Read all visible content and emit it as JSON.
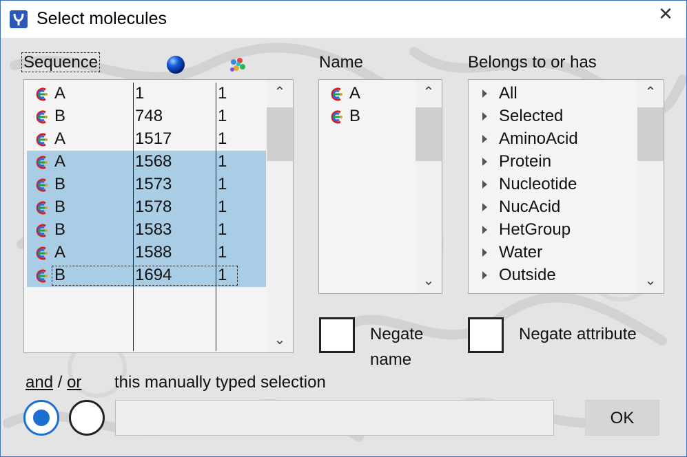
{
  "window": {
    "title": "Select molecules",
    "close_glyph": "✕"
  },
  "sequence_panel": {
    "header_label": "Sequence",
    "header_icons": [
      "blue-sphere-icon",
      "molecule-cluster-icon"
    ],
    "rows": [
      {
        "chain": "A",
        "number": "1",
        "count": "1",
        "selected": false
      },
      {
        "chain": "B",
        "number": "748",
        "count": "1",
        "selected": false
      },
      {
        "chain": "A",
        "number": "1517",
        "count": "1",
        "selected": false
      },
      {
        "chain": "A",
        "number": "1568",
        "count": "1",
        "selected": true
      },
      {
        "chain": "B",
        "number": "1573",
        "count": "1",
        "selected": true
      },
      {
        "chain": "B",
        "number": "1578",
        "count": "1",
        "selected": true
      },
      {
        "chain": "B",
        "number": "1583",
        "count": "1",
        "selected": true
      },
      {
        "chain": "A",
        "number": "1588",
        "count": "1",
        "selected": true
      },
      {
        "chain": "B",
        "number": "1694",
        "count": "1",
        "selected": true
      }
    ]
  },
  "name_panel": {
    "header_label": "Name",
    "items": [
      {
        "chain": "A"
      },
      {
        "chain": "B"
      }
    ]
  },
  "belongs_panel": {
    "header_label": "Belongs to or has",
    "items": [
      "All",
      "Selected",
      "AminoAcid",
      "Protein",
      "Nucleotide",
      "NucAcid",
      "HetGroup",
      "Water",
      "Outside"
    ]
  },
  "negate_name": {
    "label_line1": "Negate",
    "label_line2": "name",
    "checked": false
  },
  "negate_attribute": {
    "label": "Negate attribute",
    "checked": false
  },
  "combine": {
    "and_label": "and",
    "separator": "/",
    "or_label": "or",
    "selected": "and"
  },
  "manual": {
    "label": "this manually typed selection",
    "value": "",
    "placeholder": ""
  },
  "ok_button": {
    "label": "OK"
  },
  "colors": {
    "selection": "#a9cde4",
    "radio_accent": "#1a6fd0",
    "window_border": "#3a6fc1"
  }
}
